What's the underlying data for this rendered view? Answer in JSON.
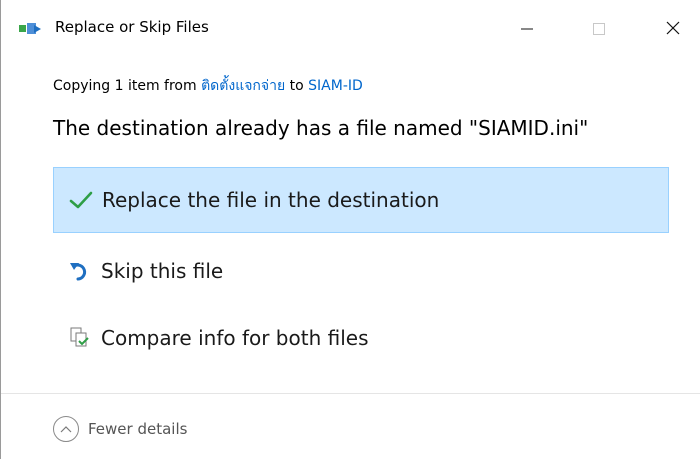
{
  "window": {
    "title": "Replace or Skip Files",
    "icon": "copy-files-icon"
  },
  "title_buttons": {
    "minimize": "minimize-icon",
    "maximize": "maximize-icon",
    "close": "close-icon"
  },
  "copy_status": {
    "prefix": "Copying 1 item from ",
    "source": "ติดตั้งแจกจ่าย",
    "connector": " to ",
    "destination": "SIAM-ID"
  },
  "message": "The destination already has a file named \"SIAMID.ini\"",
  "options": [
    {
      "label": "Replace the file in the destination",
      "icon": "checkmark-icon",
      "selected": true
    },
    {
      "label": "Skip this file",
      "icon": "skip-arrow-icon",
      "selected": false
    },
    {
      "label": "Compare info for both files",
      "icon": "compare-files-icon",
      "selected": false
    }
  ],
  "footer": {
    "toggle_label": "Fewer details",
    "toggle_icon": "chevron-up-icon"
  },
  "colors": {
    "accent_link": "#0066cc",
    "selection_bg": "#cce8ff",
    "selection_border": "#99d1ff",
    "check_green": "#2e9e46",
    "skip_blue": "#1f6fc1"
  }
}
